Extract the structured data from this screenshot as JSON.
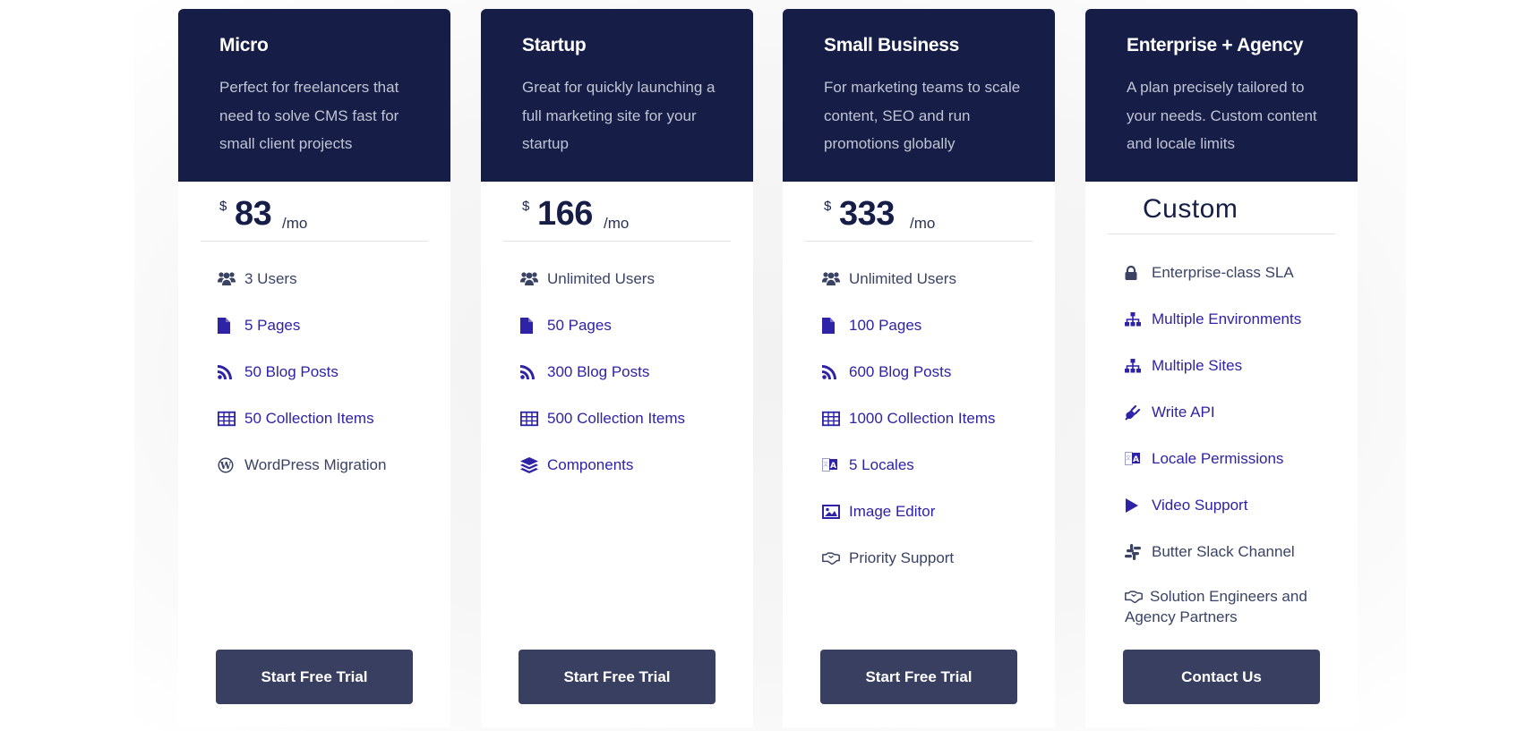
{
  "colors": {
    "header_bg": "#161e48",
    "button_bg": "#383f60",
    "feature_gray": "#3a4364",
    "feature_indigo": "#2e22a6"
  },
  "plans": [
    {
      "name": "Micro",
      "description": "Perfect for freelancers that need to solve CMS fast for small client projects",
      "price": {
        "currency": "$",
        "amount": "83",
        "period": "/mo"
      },
      "features": [
        {
          "icon": "users-icon",
          "label": "3 Users",
          "tone": "gray"
        },
        {
          "icon": "file-icon",
          "label": "5 Pages",
          "tone": "indigo"
        },
        {
          "icon": "rss-icon",
          "label": "50 Blog Posts",
          "tone": "indigo"
        },
        {
          "icon": "table-icon",
          "label": "50 Collection Items",
          "tone": "indigo"
        },
        {
          "icon": "wordpress-icon",
          "label": "WordPress Migration",
          "tone": "gray"
        }
      ],
      "cta": "Start Free Trial"
    },
    {
      "name": "Startup",
      "description": "Great for quickly launching a full marketing site for your startup",
      "price": {
        "currency": "$",
        "amount": "166",
        "period": "/mo"
      },
      "features": [
        {
          "icon": "users-icon",
          "label": "Unlimited Users",
          "tone": "gray"
        },
        {
          "icon": "file-icon",
          "label": "50 Pages",
          "tone": "indigo"
        },
        {
          "icon": "rss-icon",
          "label": "300 Blog Posts",
          "tone": "indigo"
        },
        {
          "icon": "table-icon",
          "label": "500 Collection Items",
          "tone": "indigo"
        },
        {
          "icon": "layers-icon",
          "label": "Components",
          "tone": "indigo"
        }
      ],
      "cta": "Start Free Trial"
    },
    {
      "name": "Small Business",
      "description": "For marketing teams to scale content, SEO and run promotions globally",
      "price": {
        "currency": "$",
        "amount": "333",
        "period": "/mo"
      },
      "features": [
        {
          "icon": "users-icon",
          "label": "Unlimited Users",
          "tone": "gray"
        },
        {
          "icon": "file-icon",
          "label": "100 Pages",
          "tone": "indigo"
        },
        {
          "icon": "rss-icon",
          "label": "600 Blog Posts",
          "tone": "indigo"
        },
        {
          "icon": "table-icon",
          "label": "1000 Collection Items",
          "tone": "indigo"
        },
        {
          "icon": "translate-icon",
          "label": "5 Locales",
          "tone": "indigo"
        },
        {
          "icon": "image-icon",
          "label": "Image Editor",
          "tone": "indigo"
        },
        {
          "icon": "handshake-icon",
          "label": "Priority Support",
          "tone": "gray"
        }
      ],
      "cta": "Start Free Trial"
    },
    {
      "name": "Enterprise + Agency",
      "description": "A plan precisely tailored to your needs. Custom content and locale limits",
      "price_text": "Custom",
      "features": [
        {
          "icon": "lock-icon",
          "label": "Enterprise-class SLA",
          "tone": "gray"
        },
        {
          "icon": "sitemap-icon",
          "label": "Multiple Environments",
          "tone": "indigo"
        },
        {
          "icon": "sitemap-icon",
          "label": "Multiple Sites",
          "tone": "indigo"
        },
        {
          "icon": "plug-icon",
          "label": "Write API",
          "tone": "indigo"
        },
        {
          "icon": "translate-icon",
          "label": "Locale Permissions",
          "tone": "indigo"
        },
        {
          "icon": "play-icon",
          "label": "Video Support",
          "tone": "indigo"
        },
        {
          "icon": "slack-icon",
          "label": "Butter Slack Channel",
          "tone": "gray"
        },
        {
          "icon": "handshake-icon",
          "label": "Solution Engineers and Agency Partners",
          "tone": "gray"
        }
      ],
      "cta": "Contact Us"
    }
  ]
}
